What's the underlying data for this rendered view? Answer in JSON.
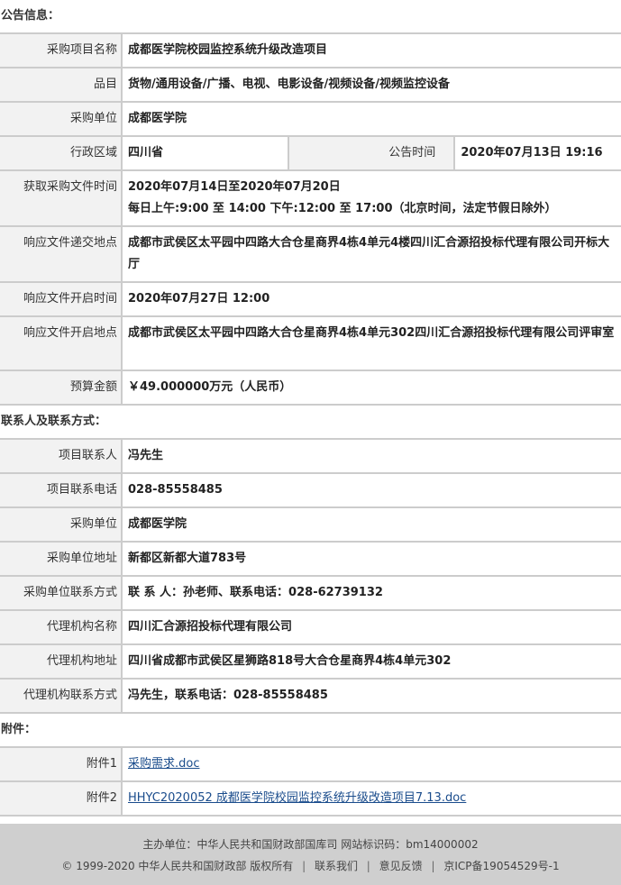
{
  "sections": {
    "announcement": "公告信息：",
    "contact": "联系人及联系方式：",
    "attachments": "附件："
  },
  "announcement": {
    "project_name": {
      "label": "采购项目名称",
      "value": "成都医学院校园监控系统升级改造项目"
    },
    "category": {
      "label": "品目",
      "value": "货物/通用设备/广播、电视、电影设备/视频设备/视频监控设备"
    },
    "purchaser": {
      "label": "采购单位",
      "value": "成都医学院"
    },
    "region": {
      "label": "行政区域",
      "value": "四川省"
    },
    "publish_time": {
      "label": "公告时间",
      "value": "2020年07月13日 19:16"
    },
    "doc_time": {
      "label": "获取采购文件时间",
      "line1": "2020年07月14日至2020年07月20日",
      "line2": "每日上午:9:00 至 14:00  下午:12:00 至 17:00（北京时间，法定节假日除外）"
    },
    "submit_place": {
      "label": "响应文件递交地点",
      "value": "成都市武侯区太平园中四路大合仓星商界4栋4单元4楼四川汇合源招投标代理有限公司开标大厅"
    },
    "open_time": {
      "label": "响应文件开启时间",
      "value": "2020年07月27日 12:00"
    },
    "open_place": {
      "label": "响应文件开启地点",
      "value": "成都市武侯区太平园中四路大合仓星商界4栋4单元302四川汇合源招投标代理有限公司评审室"
    },
    "budget": {
      "label": "预算金额",
      "value": "￥49.000000万元（人民币）"
    }
  },
  "contact": {
    "project_contact": {
      "label": "项目联系人",
      "value": "冯先生"
    },
    "project_phone": {
      "label": "项目联系电话",
      "value": "028-85558485"
    },
    "purchaser": {
      "label": "采购单位",
      "value": "成都医学院"
    },
    "purchaser_address": {
      "label": "采购单位地址",
      "value": "新都区新都大道783号"
    },
    "purchaser_contact": {
      "label": "采购单位联系方式",
      "value": "联 系 人：孙老师、联系电话：028-62739132"
    },
    "agency_name": {
      "label": "代理机构名称",
      "value": "四川汇合源招投标代理有限公司"
    },
    "agency_address": {
      "label": "代理机构地址",
      "value": "四川省成都市武侯区星狮路818号大合仓星商界4栋4单元302"
    },
    "agency_contact": {
      "label": "代理机构联系方式",
      "value": "冯先生，联系电话：028-85558485"
    }
  },
  "attachments": [
    {
      "label": "附件1",
      "file": "采购需求.doc"
    },
    {
      "label": "附件2",
      "file": "HHYC2020052 成都医学院校园监控系统升级改造项目7.13.doc"
    }
  ],
  "footer": {
    "line1": "主办单位：中华人民共和国财政部国库司 网站标识码：bm14000002",
    "copyright": "© 1999-2020 中华人民共和国财政部 版权所有",
    "contact_us": "联系我们",
    "feedback": "意见反馈",
    "icp": "京ICP备19054529号-1",
    "separator": "|"
  }
}
